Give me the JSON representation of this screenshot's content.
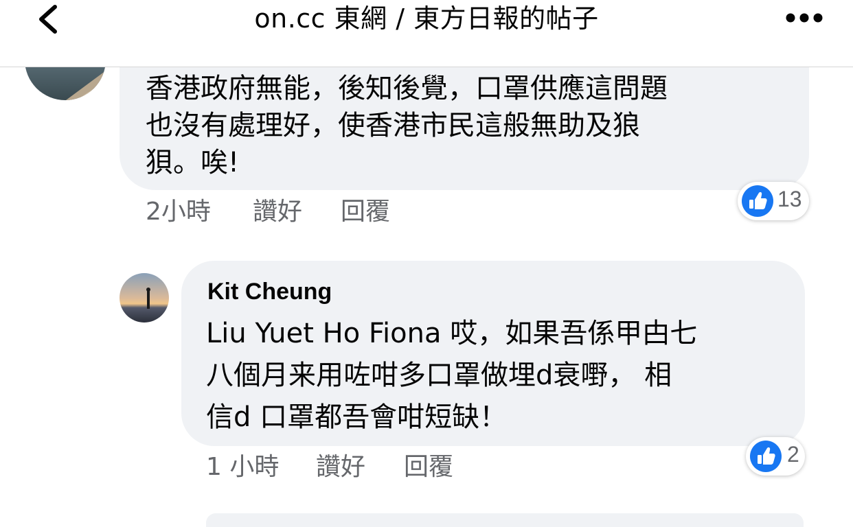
{
  "header": {
    "title": "on.cc 東網 / 東方日報的帖子"
  },
  "comments": [
    {
      "text_lines": [
        "香港政府無能，後知後覺，口罩供應這問題",
        "也沒有處理好，使香港市民這般無助及狼",
        "狽。唉!"
      ],
      "time": "2小時",
      "like_label": "讚好",
      "reply_label": "回覆",
      "reaction_count": "13"
    },
    {
      "author": "Kit Cheung",
      "text_lines": [
        "Liu Yuet Ho Fiona 哎，如果吾係甲甴七",
        "八個月来用咗咁多口罩做埋d衰嘢， 相",
        "信d 口罩都吾會咁短缺！"
      ],
      "time": "1 小時",
      "like_label": "讚好",
      "reply_label": "回覆",
      "reaction_count": "2"
    }
  ],
  "colors": {
    "bubble": "#f0f2f5",
    "meta_text": "#65676b",
    "like_blue": "#1877f2"
  }
}
